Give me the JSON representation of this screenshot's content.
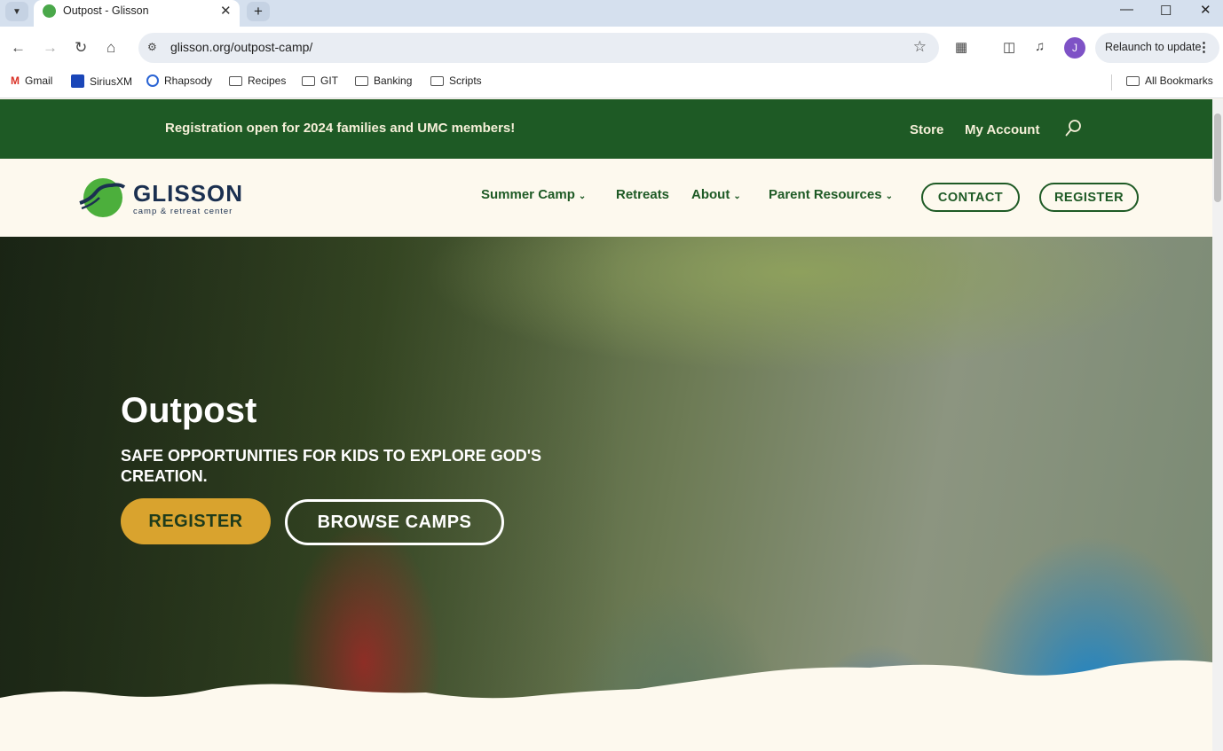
{
  "browser": {
    "tab_title": "Outpost - Glisson",
    "url": "glisson.org/outpost-camp/",
    "profile_initial": "J",
    "relaunch_label": "Relaunch to update",
    "bookmarks": [
      "Gmail",
      "SiriusXM",
      "Rhapsody",
      "Recipes",
      "GIT",
      "Banking",
      "Scripts"
    ],
    "all_bookmarks": "All Bookmarks"
  },
  "site": {
    "announcement": "Registration open for 2024 families and UMC members!",
    "store": "Store",
    "my_account": "My Account",
    "logo_word": "GLISSON",
    "logo_sub": "camp & retreat center",
    "nav": {
      "summer_camp": "Summer Camp",
      "retreats": "Retreats",
      "about": "About",
      "parent_resources": "Parent Resources",
      "contact": "CONTACT",
      "register": "REGISTER"
    },
    "hero": {
      "title": "Outpost",
      "subtitle": "SAFE OPPORTUNITIES FOR KIDS TO EXPLORE GOD'S CREATION.",
      "register_button": "REGISTER",
      "browse_button": "BROWSE CAMPS"
    }
  },
  "colors": {
    "brand_green": "#1e5a25",
    "cream": "#fdf9ee",
    "gold": "#d9a32e",
    "navy": "#1b3050"
  }
}
